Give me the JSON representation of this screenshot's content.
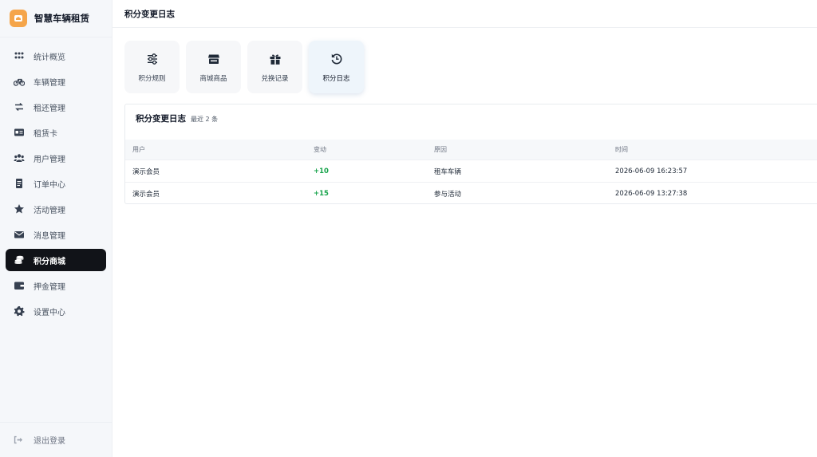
{
  "app": {
    "title": "智慧车辆租赁"
  },
  "sidebar": {
    "items": [
      {
        "label": "统计概览",
        "icon": "grid-icon",
        "active": false
      },
      {
        "label": "车辆管理",
        "icon": "bicycle-icon",
        "active": false
      },
      {
        "label": "租还管理",
        "icon": "swap-icon",
        "active": false
      },
      {
        "label": "租赁卡",
        "icon": "id-card-icon",
        "active": false
      },
      {
        "label": "用户管理",
        "icon": "users-icon",
        "active": false
      },
      {
        "label": "订单中心",
        "icon": "document-icon",
        "active": false
      },
      {
        "label": "活动管理",
        "icon": "star-icon",
        "active": false
      },
      {
        "label": "消息管理",
        "icon": "envelope-icon",
        "active": false
      },
      {
        "label": "积分商城",
        "icon": "coins-icon",
        "active": true
      },
      {
        "label": "押金管理",
        "icon": "wallet-icon",
        "active": false
      },
      {
        "label": "设置中心",
        "icon": "gear-icon",
        "active": false
      }
    ],
    "logout_label": "退出登录"
  },
  "page": {
    "title": "积分变更日志"
  },
  "tiles": [
    {
      "label": "积分规则",
      "icon": "sliders-icon"
    },
    {
      "label": "商城商品",
      "icon": "store-icon"
    },
    {
      "label": "兑换记录",
      "icon": "gift-icon"
    },
    {
      "label": "积分日志",
      "icon": "history-icon"
    }
  ],
  "log": {
    "title": "积分变更日志",
    "subtitle": "最近 2 条",
    "columns": [
      "用户",
      "变动",
      "原因",
      "时间"
    ],
    "rows": [
      {
        "user": "演示会员",
        "change": "+10",
        "reason": "租车车辆",
        "time": "2026-06-09 16:23:57"
      },
      {
        "user": "演示会员",
        "change": "+15",
        "reason": "参与活动",
        "time": "2026-06-09 13:27:38"
      }
    ]
  },
  "colors": {
    "accent": "#111318",
    "brand": "#f5a54a",
    "positive": "#16a34a"
  }
}
